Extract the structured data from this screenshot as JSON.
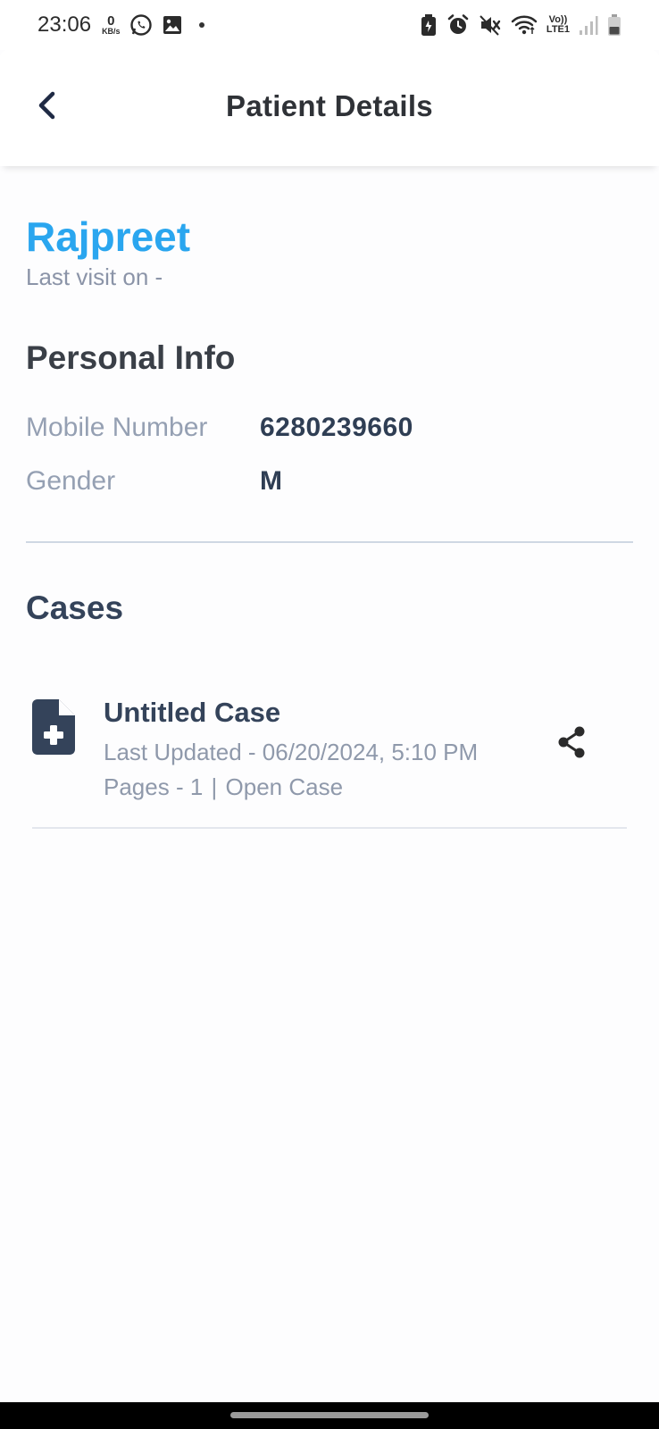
{
  "status_bar": {
    "time": "23:06",
    "net_speed_value": "0",
    "net_speed_unit": "KB/s",
    "left_icons": [
      "whatsapp-icon",
      "gallery-icon",
      "dot-indicator"
    ],
    "right_icons": [
      "battery-saver-icon",
      "alarm-icon",
      "mute-icon",
      "wifi-icon",
      "volte-icon",
      "signal-icon",
      "battery-icon"
    ],
    "volte_line1": "Vo))",
    "volte_line2": "LTE1"
  },
  "header": {
    "title": "Patient Details",
    "back_icon": "chevron-left-icon"
  },
  "patient": {
    "name": "Rajpreet",
    "last_visit": "Last visit on -"
  },
  "personal_info": {
    "title": "Personal Info",
    "rows": [
      {
        "label": "Mobile Number",
        "value": "6280239660"
      },
      {
        "label": "Gender",
        "value": "M"
      }
    ]
  },
  "cases": {
    "title": "Cases",
    "items": [
      {
        "title": "Untitled Case",
        "last_updated": "Last Updated -  06/20/2024, 5:10 PM",
        "pages": "Pages - 1",
        "separator": "|",
        "open_case": "Open Case",
        "icon": "medical-file-icon",
        "action_icon": "share-icon"
      }
    ]
  },
  "colors": {
    "accent": "#2aa6ef",
    "text_dark": "#34435a",
    "text_muted": "#8f99ab"
  }
}
